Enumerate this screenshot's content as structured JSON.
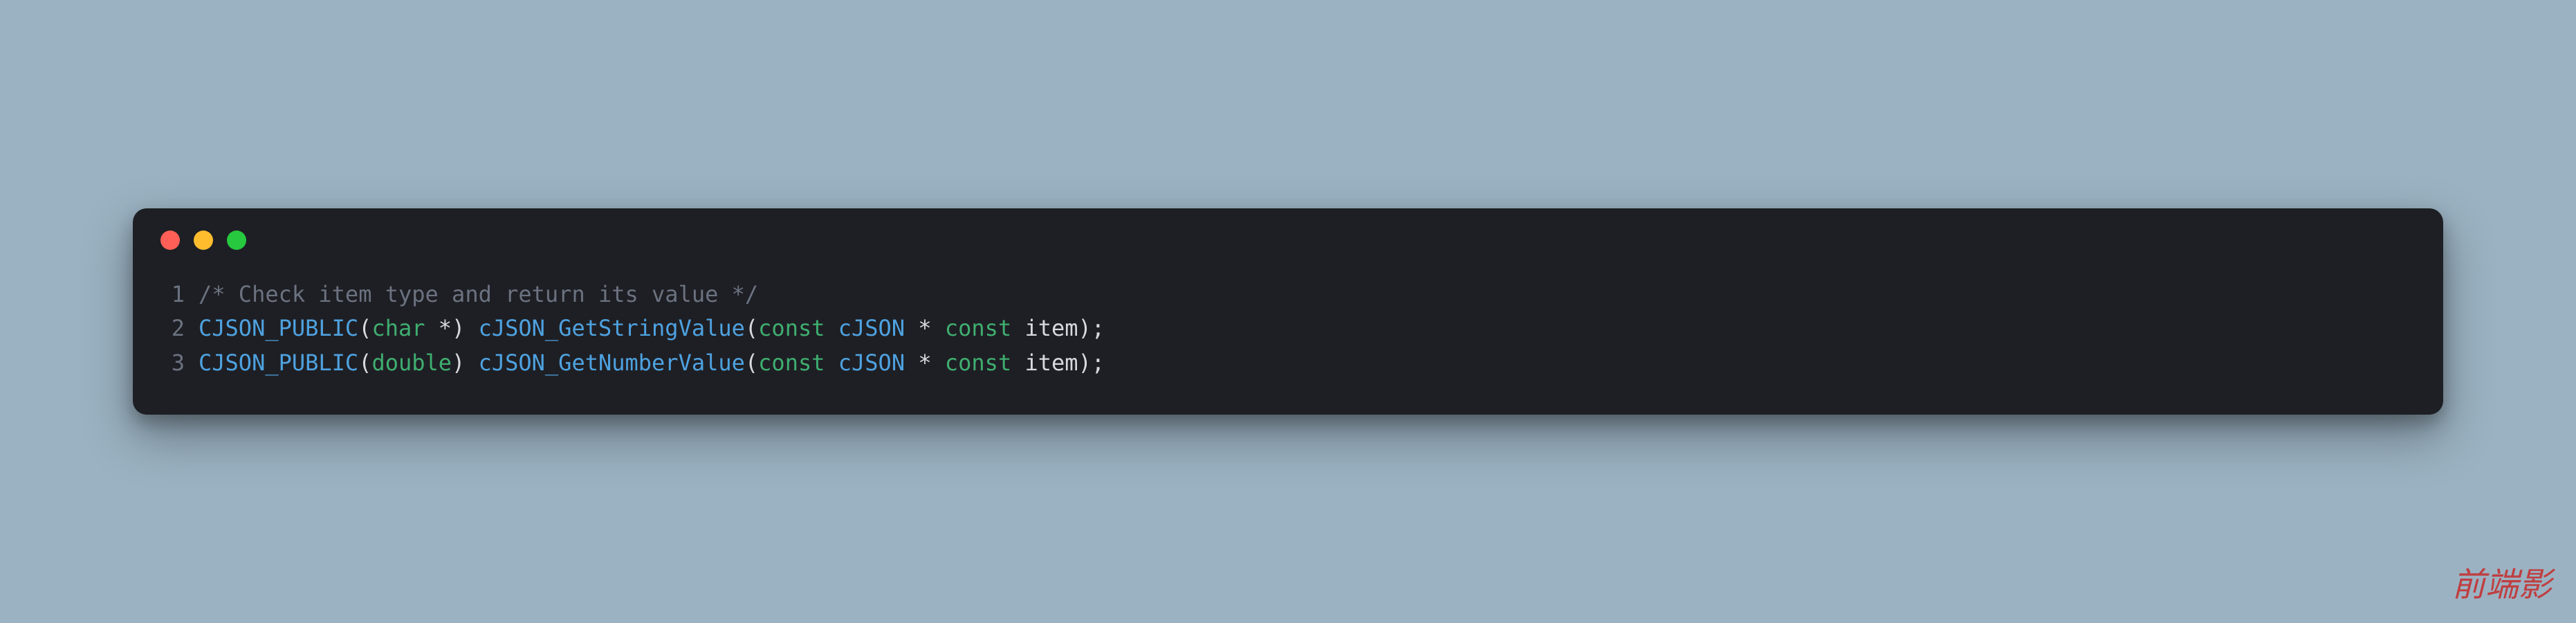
{
  "traffic": {
    "red": "close-window",
    "yellow": "minimize-window",
    "green": "zoom-window"
  },
  "code": {
    "lines": [
      {
        "num": "1",
        "tokens": [
          {
            "cls": "tok-comment",
            "text": "/* Check item type and return its value */"
          }
        ]
      },
      {
        "num": "2",
        "tokens": [
          {
            "cls": "tok-func",
            "text": "CJSON_PUBLIC"
          },
          {
            "cls": "tok-punc",
            "text": "("
          },
          {
            "cls": "tok-keyword",
            "text": "char"
          },
          {
            "cls": "tok-default",
            "text": " *"
          },
          {
            "cls": "tok-punc",
            "text": ") "
          },
          {
            "cls": "tok-func",
            "text": "cJSON_GetStringValue"
          },
          {
            "cls": "tok-punc",
            "text": "("
          },
          {
            "cls": "tok-keyword",
            "text": "const"
          },
          {
            "cls": "tok-default",
            "text": " "
          },
          {
            "cls": "tok-type",
            "text": "cJSON"
          },
          {
            "cls": "tok-default",
            "text": " * "
          },
          {
            "cls": "tok-keyword",
            "text": "const"
          },
          {
            "cls": "tok-default",
            "text": " item"
          },
          {
            "cls": "tok-punc",
            "text": ");"
          }
        ]
      },
      {
        "num": "3",
        "tokens": [
          {
            "cls": "tok-func",
            "text": "CJSON_PUBLIC"
          },
          {
            "cls": "tok-punc",
            "text": "("
          },
          {
            "cls": "tok-keyword",
            "text": "double"
          },
          {
            "cls": "tok-punc",
            "text": ") "
          },
          {
            "cls": "tok-func",
            "text": "cJSON_GetNumberValue"
          },
          {
            "cls": "tok-punc",
            "text": "("
          },
          {
            "cls": "tok-keyword",
            "text": "const"
          },
          {
            "cls": "tok-default",
            "text": " "
          },
          {
            "cls": "tok-type",
            "text": "cJSON"
          },
          {
            "cls": "tok-default",
            "text": " * "
          },
          {
            "cls": "tok-keyword",
            "text": "const"
          },
          {
            "cls": "tok-default",
            "text": " item"
          },
          {
            "cls": "tok-punc",
            "text": ");"
          }
        ]
      }
    ]
  },
  "watermark": "前端影"
}
